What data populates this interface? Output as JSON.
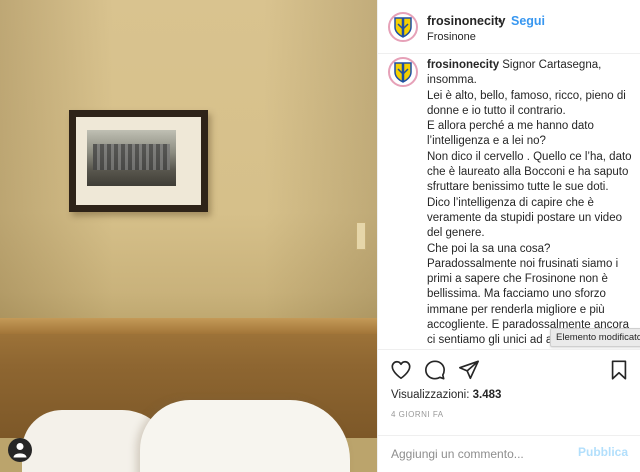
{
  "post": {
    "username": "frosinonecity",
    "follow_separator": "•",
    "follow_label": "Segui",
    "location": "Frosinone"
  },
  "caption": {
    "username": "frosinonecity",
    "lines": [
      "Signor Cartasegna, insomma.",
      "Lei è alto, bello, famoso, ricco, pieno di donne e io tutto il contrario.",
      "E allora perché a me hanno dato l’intelligenza e a lei no?",
      "Non dico il cervello . Quello ce l’ha, dato che è laureato alla Bocconi e ha saputo sfruttare benissimo tutte le sue doti.",
      "Dico l’intelligenza di capire che è veramente da stupidi postare un video del genere.",
      "Che poi la sa una cosa?",
      "Paradossalmente noi frusinati siamo i primi a sapere che Frosinone non è bellissima. Ma facciamo uno sforzo immane per renderla migliore e più accogliente. E paradossalmente ancora ci sentiamo gli unici ad avere il titolo di dire che questa città non lo è. Invece,"
    ]
  },
  "tooltip": "Elemento modificato",
  "stats": {
    "views_label": "Visualizzazioni:",
    "views_count": "3.483",
    "time_ago": "4 GIORNI FA"
  },
  "comment_box": {
    "placeholder": "Aggiungi un commento...",
    "publish_label": "Pubblica"
  },
  "icons": {
    "like": "heart-icon",
    "comment": "comment-bubble-icon",
    "share": "paper-plane-icon",
    "save": "bookmark-icon",
    "user": "user-icon",
    "logo": "frosinone-crest-logo"
  },
  "colors": {
    "link_blue": "#3897f0",
    "publish_disabled": "#b2dffc",
    "logo_ring": "#e6a1b8"
  }
}
